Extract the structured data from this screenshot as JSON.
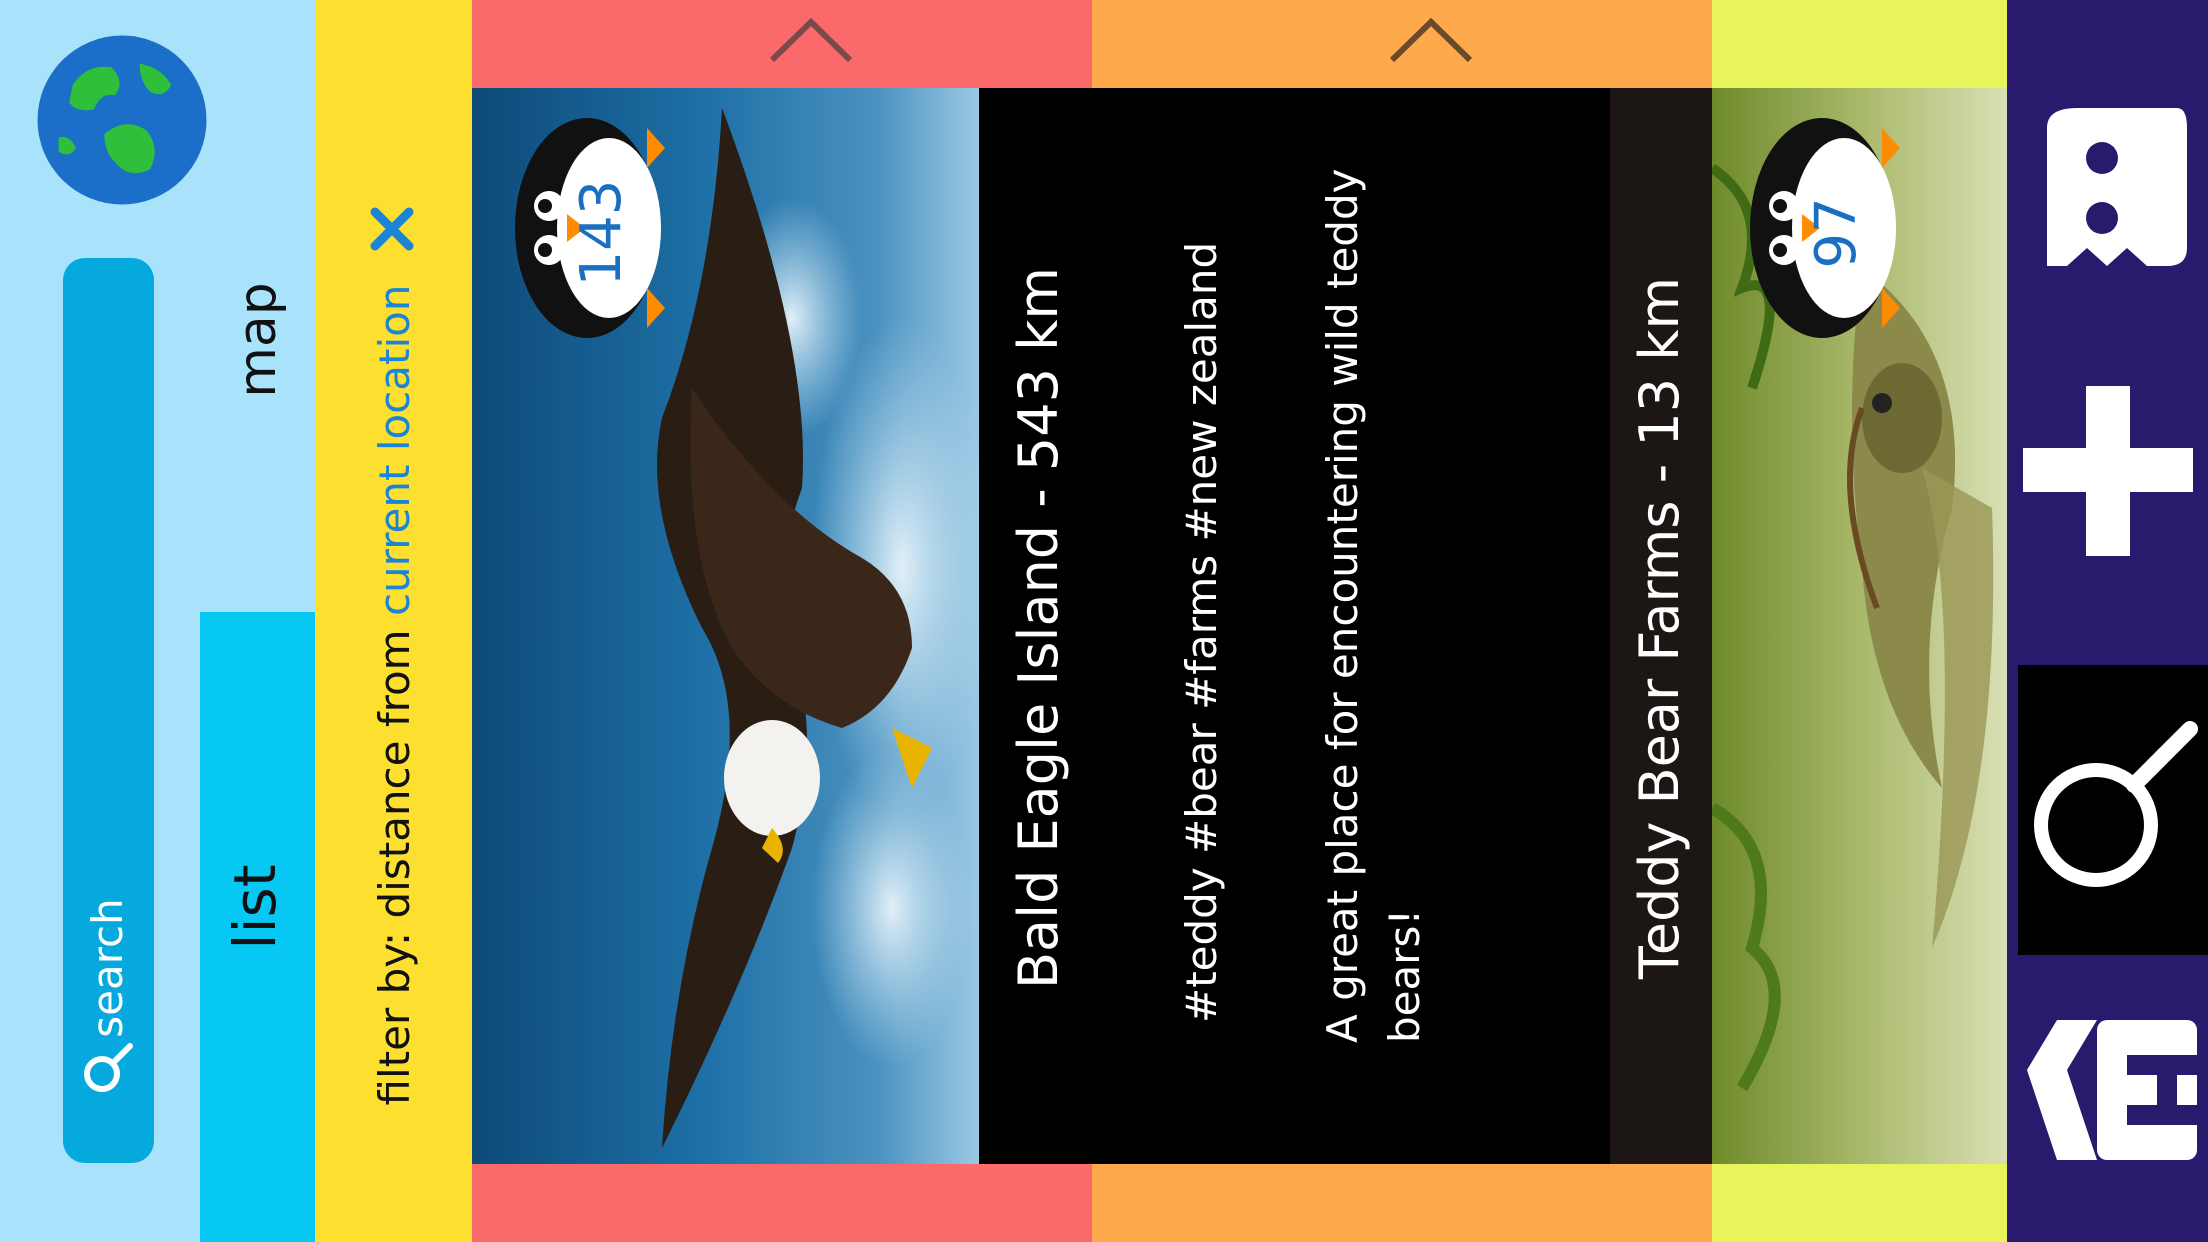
{
  "nav": {
    "search_label": "search",
    "tabs": [
      {
        "label": "map",
        "selected": false
      },
      {
        "label": "list",
        "selected": true
      }
    ]
  },
  "filter": {
    "prefix": "filter by: distance from",
    "link_text": "current location",
    "close_icon": "close-x-icon"
  },
  "cards": [
    {
      "caption": "Bald Eagle Island - 543 km",
      "badge_count": "143",
      "accent_color": "#fb6a6a"
    },
    {
      "caption": "Teddy Bear Farms - 13 km",
      "tags": "#teddy #bear #farms #new zealand",
      "description": "A great place for encountering wild teddy bears!",
      "accent_color": "#fda94c"
    },
    {
      "badge_count": "97",
      "accent_color": "#e8f55a"
    }
  ],
  "toolbar": {
    "icons": [
      "ghost-icon",
      "plus-icon",
      "magnifier-icon",
      "tag-e-icon"
    ]
  },
  "colors": {
    "nav_bg": "#a9e3fb",
    "search_pill": "#06a9dd",
    "list_tab": "#06c8f2",
    "filter_bg": "#fde02f",
    "link": "#1a84d6",
    "toolbar_bg": "#2a1a6e"
  }
}
